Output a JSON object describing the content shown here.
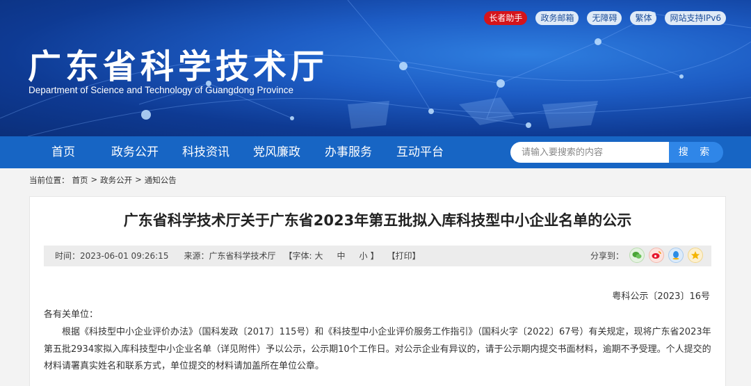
{
  "header": {
    "site_title": "广东省科学技术厅",
    "site_subtitle": "Department of Science and Technology of Guangdong Province",
    "top_links": [
      "长者助手",
      "政务邮箱",
      "无障碍",
      "繁体",
      "网站支持IPv6"
    ]
  },
  "nav": {
    "items": [
      "首页",
      "政务公开",
      "科技资讯",
      "党风廉政",
      "办事服务",
      "互动平台"
    ],
    "search_placeholder": "请输入要搜索的内容",
    "search_button": "搜 索"
  },
  "breadcrumb": {
    "prefix": "当前位置：",
    "items": [
      "首页",
      "政务公开",
      "通知公告"
    ],
    "separator": ">"
  },
  "article": {
    "title": "广东省科学技术厅关于广东省2023年第五批拟入库科技型中小企业名单的公示",
    "meta": {
      "time": "时间：2023-06-01 09:26:15",
      "source": "来源：广东省科学技术厅",
      "font_open": "【字体:",
      "font_large": "大",
      "font_medium": "中",
      "font_small": "小",
      "font_close": "】",
      "print": "【打印】",
      "share_label": "分享到："
    },
    "share_icons": [
      "wechat-icon",
      "weibo-icon",
      "qq-icon",
      "qzone-icon"
    ],
    "doc_number": "粤科公示〔2023〕16号",
    "salutation": "各有关单位：",
    "body": "根据《科技型中小企业评价办法》（国科发政〔2017〕115号）和《科技型中小企业评价服务工作指引》（国科火字〔2022〕67号）有关规定，现将广东省2023年第五批2934家拟入库科技型中小企业名单（详见附件）予以公示，公示期10个工作日。对公示企业有异议的，请于公示期内提交书面材料，逾期不予受理。个人提交的材料请署真实姓名和联系方式，单位提交的材料请加盖所在单位公章。"
  },
  "colors": {
    "nav_bg": "#1765c4",
    "banner_bg": "#1d5cc4",
    "red_pill": "#d4141b",
    "search_button": "#2f86e8"
  }
}
